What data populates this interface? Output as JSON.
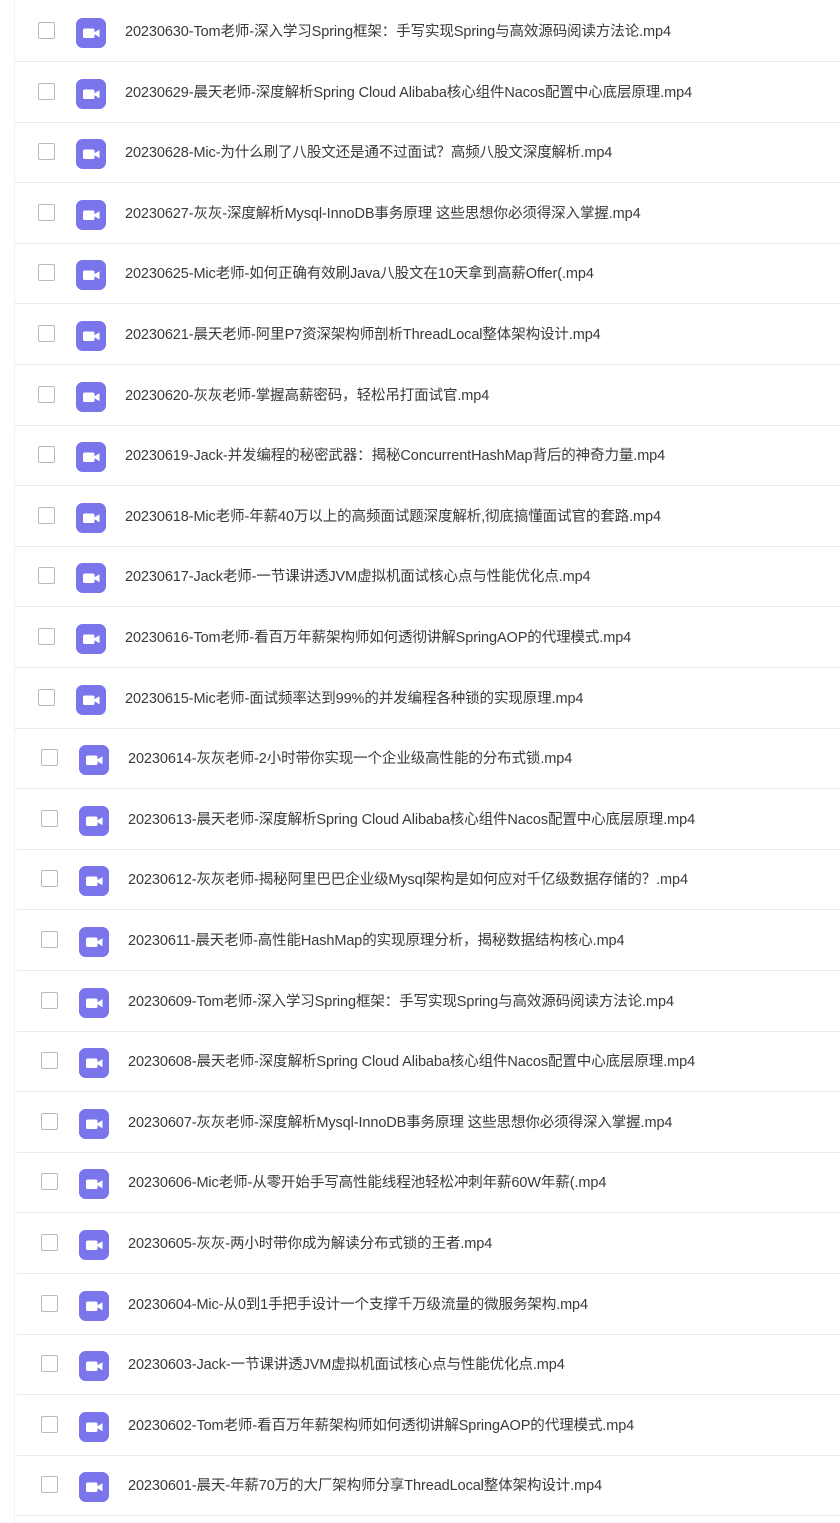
{
  "icon_color": "#7b75eb",
  "files": [
    {
      "name": "20230630-Tom老师-深入学习Spring框架：手写实现Spring与高效源码阅读方法论.mp4",
      "icon": "video-file-icon",
      "checked": false
    },
    {
      "name": "20230629-晨天老师-深度解析Spring Cloud Alibaba核心组件Nacos配置中心底层原理.mp4",
      "icon": "video-file-icon",
      "checked": false
    },
    {
      "name": "20230628-Mic-为什么刷了八股文还是通不过面试？高频八股文深度解析.mp4",
      "icon": "video-file-icon",
      "checked": false
    },
    {
      "name": "20230627-灰灰-深度解析Mysql-InnoDB事务原理 这些思想你必须得深入掌握.mp4",
      "icon": "video-file-icon",
      "checked": false
    },
    {
      "name": "20230625-Mic老师-如何正确有效刷Java八股文在10天拿到高薪Offer(.mp4",
      "icon": "video-file-icon",
      "checked": false
    },
    {
      "name": "20230621-晨天老师-阿里P7资深架构师剖析ThreadLocal整体架构设计.mp4",
      "icon": "video-file-icon",
      "checked": false
    },
    {
      "name": "20230620-灰灰老师-掌握高薪密码，轻松吊打面试官.mp4",
      "icon": "video-file-icon",
      "checked": false
    },
    {
      "name": "20230619-Jack-并发编程的秘密武器：揭秘ConcurrentHashMap背后的神奇力量.mp4",
      "icon": "video-file-icon",
      "checked": false
    },
    {
      "name": "20230618-Mic老师-年薪40万以上的高频面试题深度解析,彻底搞懂面试官的套路.mp4",
      "icon": "video-file-icon",
      "checked": false
    },
    {
      "name": "20230617-Jack老师-一节课讲透JVM虚拟机面试核心点与性能优化点.mp4",
      "icon": "video-file-icon",
      "checked": false
    },
    {
      "name": "20230616-Tom老师-看百万年薪架构师如何透彻讲解SpringAOP的代理模式.mp4",
      "icon": "video-file-icon",
      "checked": false
    },
    {
      "name": "20230615-Mic老师-面试频率达到99%的并发编程各种锁的实现原理.mp4",
      "icon": "video-file-icon",
      "checked": false
    },
    {
      "name": "20230614-灰灰老师-2小时带你实现一个企业级高性能的分布式锁.mp4",
      "icon": "video-file-icon",
      "checked": false
    },
    {
      "name": "20230613-晨天老师-深度解析Spring Cloud Alibaba核心组件Nacos配置中心底层原理.mp4",
      "icon": "video-file-icon",
      "checked": false
    },
    {
      "name": "20230612-灰灰老师-揭秘阿里巴巴企业级Mysql架构是如何应对千亿级数据存储的？.mp4",
      "icon": "video-file-icon",
      "checked": false
    },
    {
      "name": "20230611-晨天老师-高性能HashMap的实现原理分析，揭秘数据结构核心.mp4",
      "icon": "video-file-icon",
      "checked": false
    },
    {
      "name": "20230609-Tom老师-深入学习Spring框架：手写实现Spring与高效源码阅读方法论.mp4",
      "icon": "video-file-icon",
      "checked": false
    },
    {
      "name": "20230608-晨天老师-深度解析Spring Cloud Alibaba核心组件Nacos配置中心底层原理.mp4",
      "icon": "video-file-icon",
      "checked": false
    },
    {
      "name": "20230607-灰灰老师-深度解析Mysql-InnoDB事务原理 这些思想你必须得深入掌握.mp4",
      "icon": "video-file-icon",
      "checked": false
    },
    {
      "name": "20230606-Mic老师-从零开始手写高性能线程池轻松冲刺年薪60W年薪(.mp4",
      "icon": "video-file-icon",
      "checked": false
    },
    {
      "name": "20230605-灰灰-两小时带你成为解读分布式锁的王者.mp4",
      "icon": "video-file-icon",
      "checked": false
    },
    {
      "name": "20230604-Mic-从0到1手把手设计一个支撑千万级流量的微服务架构.mp4",
      "icon": "video-file-icon",
      "checked": false
    },
    {
      "name": "20230603-Jack-一节课讲透JVM虚拟机面试核心点与性能优化点.mp4",
      "icon": "video-file-icon",
      "checked": false
    },
    {
      "name": "20230602-Tom老师-看百万年薪架构师如何透彻讲解SpringAOP的代理模式.mp4",
      "icon": "video-file-icon",
      "checked": false
    },
    {
      "name": "20230601-晨天-年薪70万的大厂架构师分享ThreadLocal整体架构设计.mp4",
      "icon": "video-file-icon",
      "checked": false
    }
  ]
}
